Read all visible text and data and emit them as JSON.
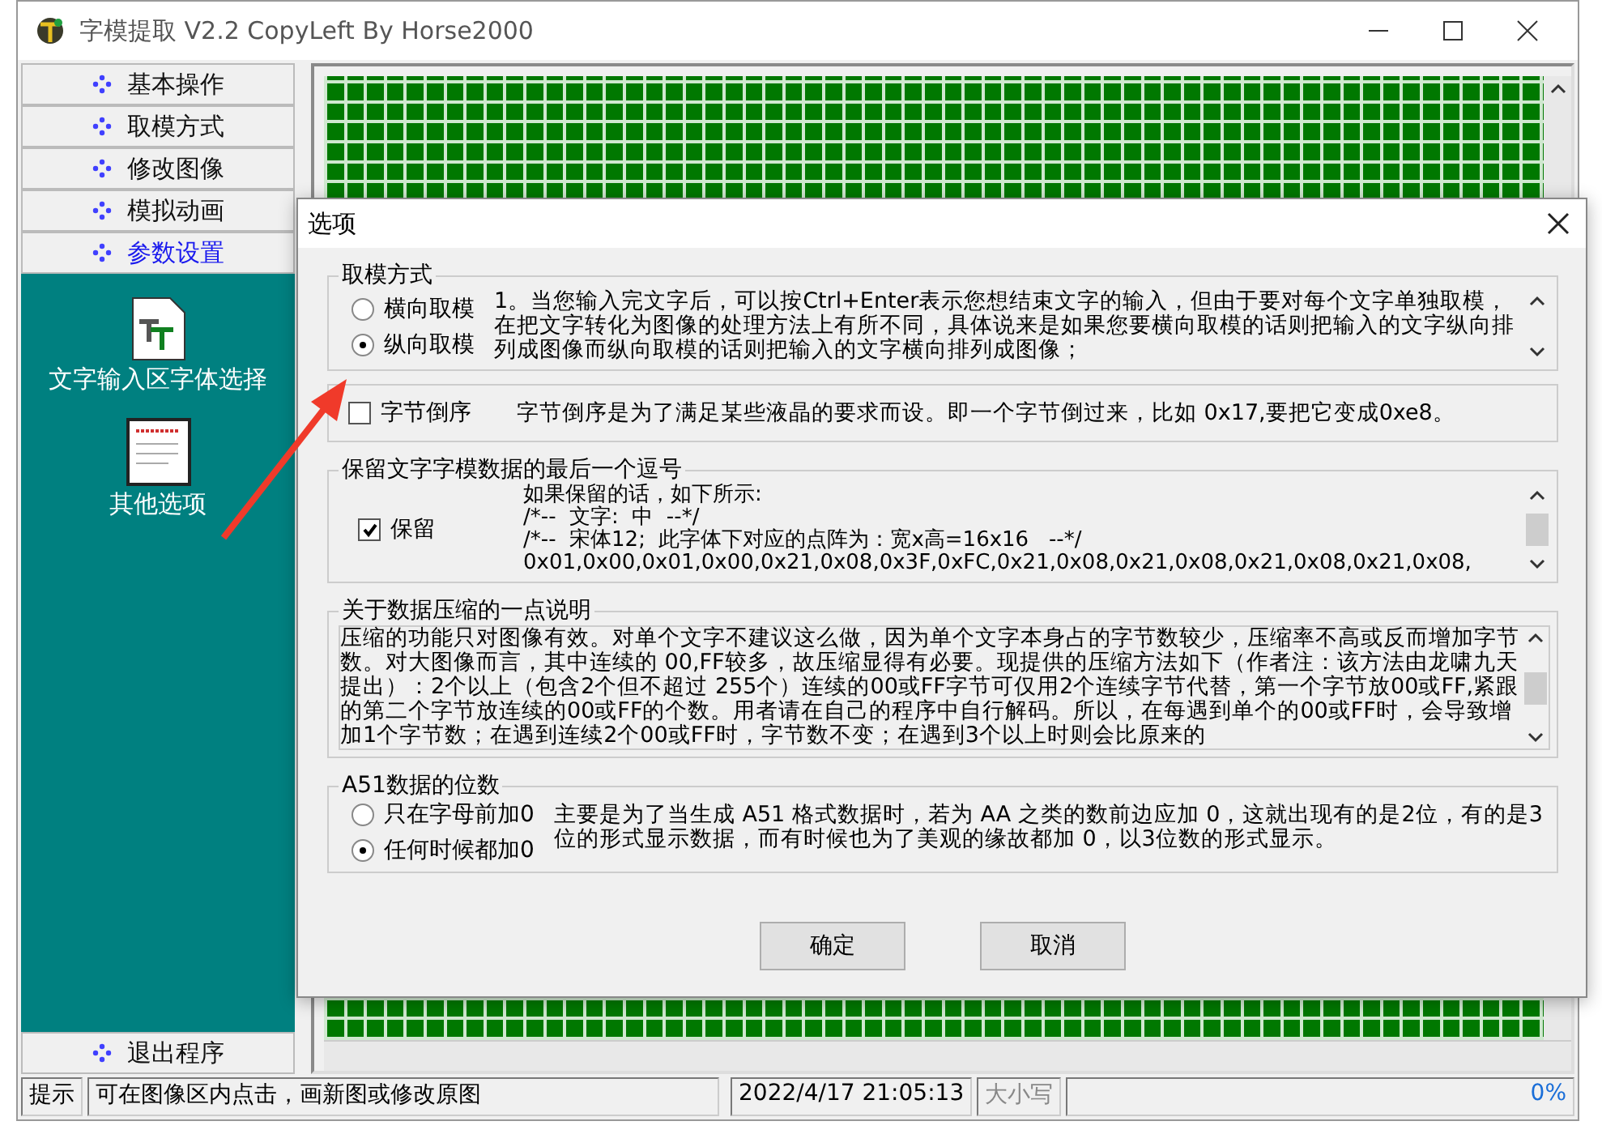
{
  "window": {
    "title": "字模提取 V2.2  CopyLeft By Horse2000"
  },
  "nav_items": [
    {
      "label": "基本操作",
      "selected": false
    },
    {
      "label": "取模方式",
      "selected": false
    },
    {
      "label": "修改图像",
      "selected": false
    },
    {
      "label": "模拟动画",
      "selected": false
    },
    {
      "label": "参数设置",
      "selected": true
    }
  ],
  "tools": [
    {
      "label": "文字输入区字体选择",
      "kind": "font"
    },
    {
      "label": "其他选项",
      "kind": "document"
    }
  ],
  "exit_item": {
    "label": "退出程序"
  },
  "status_bar": {
    "label": "提示",
    "message": "可在图像区内点击，画新图或修改原图",
    "datetime": "2022/4/17 21:05:13",
    "caps": "大小写",
    "progress": "0%"
  },
  "dialog": {
    "title": "选项",
    "mode_group": {
      "title": "取模方式",
      "options": [
        {
          "label": "横向取模",
          "selected": false
        },
        {
          "label": "纵向取模",
          "selected": true
        }
      ],
      "description": "1。当您输入完文字后，可以按Ctrl+Enter表示您想结束文字的输入，但由于要对每个文字单独取模，在把文字转化为图像的处理方法上有所不同，具体说来是如果您要横向取模的话则把输入的文字纵向排列成图像而纵向取模的话则把输入的文字横向排列成图像；"
    },
    "byte_order": {
      "label": "字节倒序",
      "checked": false,
      "description": "字节倒序是为了满足某些液晶的要求而设。即一个字节倒过来，比如 0x17,要把它变成0xe8。"
    },
    "comma_group": {
      "title": "保留文字字模数据的最后一个逗号",
      "label": "保留",
      "checked": true,
      "lines": [
        "如果保留的话，如下所示:",
        "/*--  文字:  中  --*/",
        "/*--  宋体12;  此字体下对应的点阵为：宽x高=16x16   --*/",
        "0x01,0x00,0x01,0x00,0x21,0x08,0x3F,0xFC,0x21,0x08,0x21,0x08,0x21,0x08,0x21,0x08,"
      ]
    },
    "compression": {
      "title": "关于数据压缩的一点说明",
      "text": "压缩的功能只对图像有效。对单个文字不建议这么做，因为单个文字本身占的字节数较少，压缩率不高或反而增加字节数。对大图像而言，其中连续的 00,FF较多，故压缩显得有必要。现提供的压缩方法如下（作者注：该方法由龙啸九天提出）：2个以上（包含2个但不超过 255个）连续的00或FF字节可仅用2个连续字节代替，第一个字节放00或FF,紧跟的第二个字节放连续的00或FF的个数。用者请在自己的程序中自行解码。所以，在每遇到单个的00或FF时，会导致增加1个字节数；在遇到连续2个00或FF时，字节数不变；在遇到3个以上时则会比原来的"
    },
    "a51_group": {
      "title": "A51数据的位数",
      "options": [
        {
          "label": "只在字母前加0",
          "selected": false
        },
        {
          "label": "任何时候都加0",
          "selected": true
        }
      ],
      "description": "主要是为了当生成 A51 格式数据时，若为 AA 之类的数前边应加 0，这就出现有的是2位，有的是3位的形式显示数据，而有时候也为了美观的缘故都加 0，以3位数的形式显示。"
    },
    "buttons": [
      "确定",
      "取消"
    ]
  }
}
